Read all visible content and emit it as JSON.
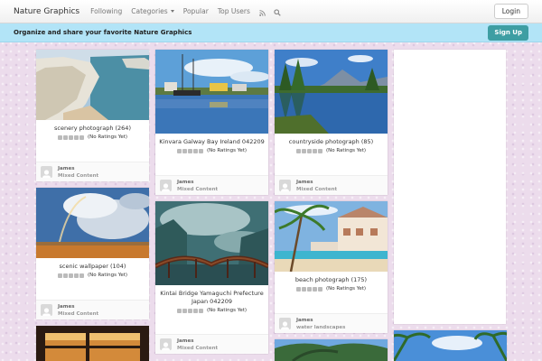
{
  "navbar": {
    "brand": "Nature Graphics",
    "links": [
      "Following",
      "Categories",
      "Popular",
      "Top Users"
    ],
    "login_label": "Login",
    "icons": [
      "rss-icon",
      "search-icon"
    ]
  },
  "banner": {
    "text": "Organize and share your favorite Nature Graphics",
    "signup_label": "Sign Up"
  },
  "pins": [
    {
      "title": "scenery photograph (264)",
      "rating_text": "(No Ratings Yet)",
      "user": "James",
      "category": "Mixed Content",
      "image": "sea-cliffs"
    },
    {
      "title": "Kinvara Galway Bay Ireland 042209",
      "rating_text": "(No Ratings Yet)",
      "user": "James",
      "category": "Mixed Content",
      "image": "harbor-boats"
    },
    {
      "title": "countryside photograph (85)",
      "rating_text": "(No Ratings Yet)",
      "user": "James",
      "category": "Mixed Content",
      "image": "lake-reflection"
    },
    {
      "title": "scenic wallpaper (104)",
      "rating_text": "(No Ratings Yet)",
      "user": "James",
      "category": "Mixed Content",
      "image": "rainbow-field"
    },
    {
      "title": "Kintai Bridge Yamaguchi Prefecture Japan 042209",
      "rating_text": "(No Ratings Yet)",
      "user": "James",
      "category": "Mixed Content",
      "image": "arched-bridge"
    },
    {
      "title": "beach photograph (175)",
      "rating_text": "(No Ratings Yet)",
      "user": "James",
      "category": "water landscapes",
      "image": "beach-resort"
    }
  ],
  "colors": {
    "banner": "#b2e4f7",
    "signup": "#3e9ea3",
    "background": "#ecdcec"
  }
}
